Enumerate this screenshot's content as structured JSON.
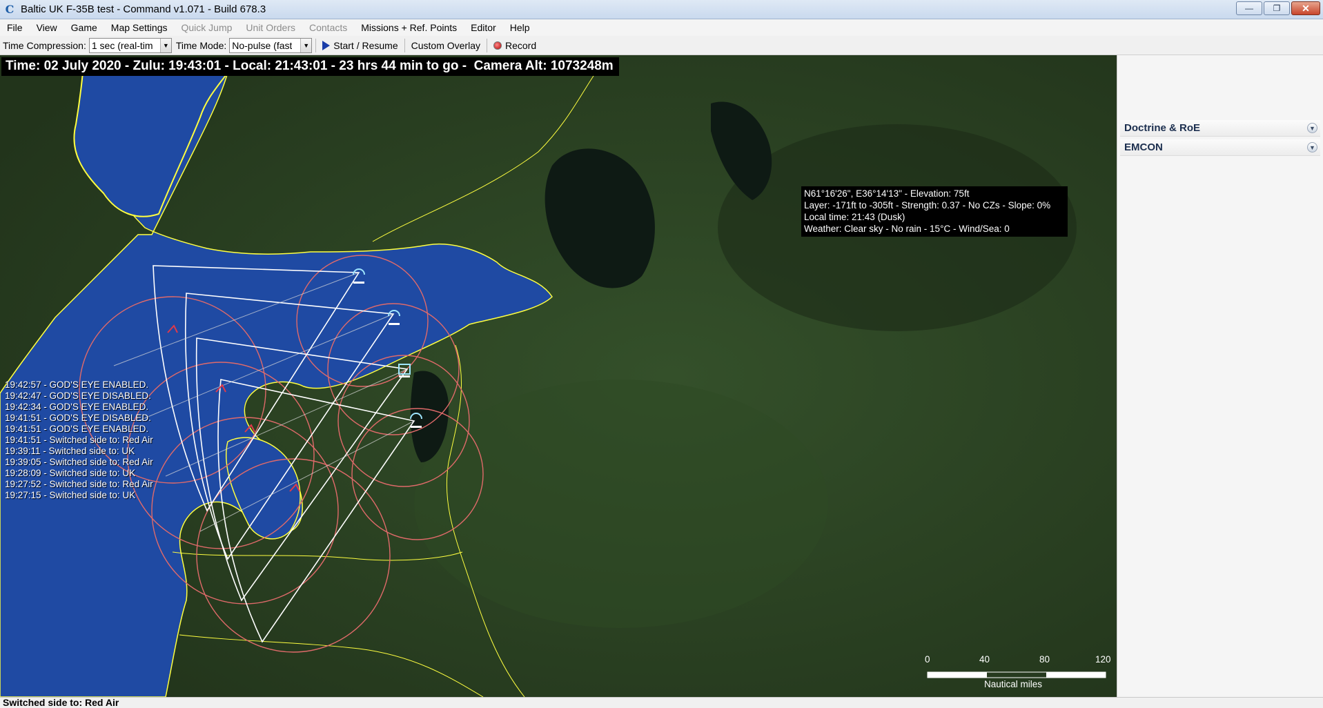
{
  "window": {
    "icon_glyph": "C",
    "title": "Baltic UK F-35B test - Command v1.071 - Build 678.3",
    "minimize_icon": "minimize-icon",
    "maximize_icon": "restore-icon",
    "close_icon": "close-icon"
  },
  "menu": {
    "items": [
      {
        "label": "File",
        "enabled": true
      },
      {
        "label": "View",
        "enabled": true
      },
      {
        "label": "Game",
        "enabled": true
      },
      {
        "label": "Map Settings",
        "enabled": true
      },
      {
        "label": "Quick Jump",
        "enabled": false
      },
      {
        "label": "Unit Orders",
        "enabled": false
      },
      {
        "label": "Contacts",
        "enabled": false
      },
      {
        "label": "Missions + Ref. Points",
        "enabled": true
      },
      {
        "label": "Editor",
        "enabled": true
      },
      {
        "label": "Help",
        "enabled": true
      }
    ]
  },
  "toolbar": {
    "time_compression_label": "Time Compression:",
    "time_compression_value": "1 sec (real-tim",
    "time_mode_label": "Time Mode:",
    "time_mode_value": "No-pulse (fast",
    "start_resume_label": "Start / Resume",
    "custom_overlay_label": "Custom Overlay",
    "record_label": "Record"
  },
  "map": {
    "time_banner": "Time: 02 July 2020 - Zulu: 19:43:01 - Local: 21:43:01 - 23 hrs 44 min to go -  Camera Alt: 1073248m",
    "info_box": [
      "N61°16'26\", E36°14'13\" - Elevation: 75ft",
      "Layer: -171ft to -305ft - Strength: 0.37 - No CZs - Slope: 0%",
      "Local time: 21:43 (Dusk)",
      "Weather: Clear sky - No rain - 15°C - Wind/Sea: 0"
    ],
    "message_log": [
      "19:42:57 - GOD'S EYE ENABLED.",
      "19:42:47 - GOD'S EYE DISABLED.",
      "19:42:34 - GOD'S EYE ENABLED.",
      "19:41:51 - GOD'S EYE DISABLED.",
      "19:41:51 - GOD'S EYE ENABLED.",
      "19:41:51 - Switched side to: Red Air",
      "19:39:11 - Switched side to: UK",
      "19:39:05 - Switched side to: Red Air",
      "19:28:09 - Switched side to: UK",
      "19:27:52 - Switched side to: Red Air",
      "19:27:15 - Switched side to: UK"
    ],
    "scale_ticks": [
      "0",
      "40",
      "80",
      "120"
    ],
    "scale_unit": "Nautical miles",
    "colors": {
      "sea": "#1f4aa3",
      "land": "#2c4320",
      "coastline": "#ffff40",
      "range_ring": "#e06a6a",
      "sector": "#ffffff"
    }
  },
  "right_panel": {
    "sections": [
      {
        "label": "Doctrine & RoE",
        "icon": "chevron-down-icon"
      },
      {
        "label": "EMCON",
        "icon": "chevron-down-icon"
      }
    ]
  },
  "status": {
    "text": "Switched side to: Red Air"
  }
}
